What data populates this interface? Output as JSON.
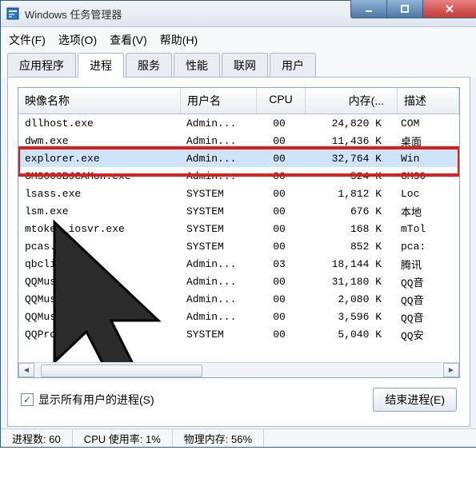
{
  "titlebar": {
    "title": "Windows 任务管理器"
  },
  "menus": {
    "file": "文件(F)",
    "options": "选项(O)",
    "view": "查看(V)",
    "help": "帮助(H)"
  },
  "tabs": {
    "apps": "应用程序",
    "processes": "进程",
    "services": "服务",
    "performance": "性能",
    "networking": "联网",
    "users": "用户"
  },
  "columns": {
    "image": "映像名称",
    "user": "用户名",
    "cpu": "CPU",
    "mem": "内存(...",
    "desc": "描述"
  },
  "rows": [
    {
      "img": "dllhost.exe",
      "user": "Admin...",
      "cpu": "00",
      "mem": "24,820 K",
      "desc": "COM"
    },
    {
      "img": "dwm.exe",
      "user": "Admin...",
      "cpu": "00",
      "mem": "11,436 K",
      "desc": "桌面"
    },
    {
      "img": "explorer.exe",
      "user": "Admin...",
      "cpu": "00",
      "mem": "32,764 K",
      "desc": "Win"
    },
    {
      "img": "GM3000BJCAMon.exe",
      "user": "Admin...",
      "cpu": "00",
      "mem": "524 K",
      "desc": "GM30"
    },
    {
      "img": "lsass.exe",
      "user": "SYSTEM",
      "cpu": "00",
      "mem": "1,812 K",
      "desc": "Loc"
    },
    {
      "img": "lsm.exe",
      "user": "SYSTEM",
      "cpu": "00",
      "mem": "676 K",
      "desc": "本地"
    },
    {
      "img": "mtoken_iosvr.exe",
      "user": "SYSTEM",
      "cpu": "00",
      "mem": "168 K",
      "desc": "mTol"
    },
    {
      "img": "pcas.e",
      "user": "SYSTEM",
      "cpu": "00",
      "mem": "852 K",
      "desc": "pca:"
    },
    {
      "img": "qbclie",
      "user": "Admin...",
      "cpu": "03",
      "mem": "18,144 K",
      "desc": "腾讯"
    },
    {
      "img": "QQMusi",
      "user": "Admin...",
      "cpu": "00",
      "mem": "31,180 K",
      "desc": "QQ音"
    },
    {
      "img": "QQMusi",
      "user": "Admin...",
      "cpu": "00",
      "mem": "2,080 K",
      "desc": "QQ音"
    },
    {
      "img": "QQMusi",
      "user": "Admin...",
      "cpu": "00",
      "mem": "3,596 K",
      "desc": "QQ音"
    },
    {
      "img": "QQProt      .e",
      "user": "SYSTEM",
      "cpu": "00",
      "mem": "5,040 K",
      "desc": "QQ安"
    }
  ],
  "selectedRowIndex": 2,
  "checkbox_label": "显示所有用户的进程(S)",
  "checkbox_checked": "✓",
  "end_button": "结束进程(E)",
  "status": {
    "procs": "进程数: 60",
    "cpu": "CPU 使用率: 1%",
    "mem": "物理内存: 56%"
  }
}
